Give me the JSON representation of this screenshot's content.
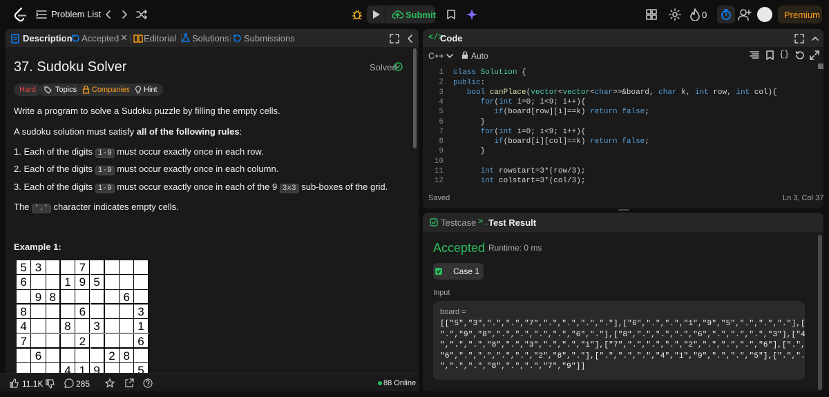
{
  "topbar": {
    "problem_list": "Problem List",
    "submit": "Submit",
    "premium": "Premium",
    "streak": "0",
    "logo": "leetcode-logo"
  },
  "left": {
    "tabs": {
      "description": "Description",
      "accepted": "Accepted",
      "editorial": "Editorial",
      "solutions": "Solutions",
      "submissions": "Submissions"
    },
    "title": "37. Sudoku Solver",
    "solved": "Solved",
    "tags": {
      "difficulty": "Hard",
      "topics": "Topics",
      "companies": "Companies",
      "hint": "Hint"
    },
    "p1": "Write a program to solve a Sudoku puzzle by filling the empty cells.",
    "p2a": "A sudoku solution must satisfy ",
    "p2b": "all of the following rules",
    ":": ":",
    "r1a": "1. Each of the digits ",
    "r1b": " must occur exactly once in each row.",
    "r2a": "2. Each of the digits ",
    "r2b": " must occur exactly once in each column.",
    "r3a": "3. Each of the digits ",
    "r3b": " must occur exactly once in each of the 9 ",
    "r3c": " sub-boxes of the grid.",
    "digits": "1-9",
    "box": "3x3",
    "p3a": "The ",
    "p3b": " character indicates empty cells.",
    "dot": "'.'",
    "example": "Example 1:",
    "grid": [
      [
        "5",
        "3",
        "",
        "",
        "7",
        "",
        "",
        "",
        ""
      ],
      [
        "6",
        "",
        "",
        "1",
        "9",
        "5",
        "",
        "",
        ""
      ],
      [
        "",
        "9",
        "8",
        "",
        "",
        "",
        "",
        "6",
        ""
      ],
      [
        "8",
        "",
        "",
        "",
        "6",
        "",
        "",
        "",
        "3"
      ],
      [
        "4",
        "",
        "",
        "8",
        "",
        "3",
        "",
        "",
        "1"
      ],
      [
        "7",
        "",
        "",
        "",
        "2",
        "",
        "",
        "",
        "6"
      ],
      [
        "",
        "6",
        "",
        "",
        "",
        "",
        "2",
        "8",
        ""
      ],
      [
        "",
        "",
        "",
        "4",
        "1",
        "9",
        "",
        "",
        "5"
      ]
    ],
    "likes": "11.1K",
    "comments": "285",
    "online": "88 Online"
  },
  "editor": {
    "header": "Code",
    "language": "C++",
    "mode": "Auto",
    "saved": "Saved",
    "cursor": "Ln 3, Col 37",
    "lines": [
      "1",
      "2",
      "3",
      "4",
      "5",
      "6",
      "7",
      "8",
      "9",
      "10",
      "11",
      "12"
    ]
  },
  "result": {
    "tabs": {
      "testcase": "Testcase",
      "test_result": "Test Result"
    },
    "status": "Accepted",
    "runtime": "Runtime: 0 ms",
    "case": "Case 1",
    "input_label": "Input",
    "var": "board =",
    "input_lines": [
      "[[\"5\",\"3\",\".\",\".\",\"7\",\".\",\".\",\".\",\".\"],[\"6\",\".\",\".\",\"1\",\"9\",\"5\",\".\",\".\",\".\"],[",
      "\".\",\"9\",\"8\",\".\",\".\",\".\",\".\",\"6\",\".\"],[\"8\",\".\",\".\",\".\",\"6\",\".\",\".\",\".\",\"3\"],[\"4",
      "\",\".\",\".\",\"8\",\".\",\"3\",\".\",\".\",\"1\"],[\"7\",\".\",\".\",\".\",\"2\",\".\",\".\",\".\",\"6\"],[\".\",",
      "\"6\",\".\",\".\",\".\",\".\",\"2\",\"8\",\".\"],[\".\",\".\",\".\",\"4\",\"1\",\"9\",\".\",\".\",\"5\"],[\".\",\".",
      "\",\".\",\".\",\"8\",\".\",\".\",\"7\",\"9\"]]"
    ]
  },
  "colors": {
    "accent": "#ffa116",
    "green": "#2cbb5d",
    "hard": "#ef4743",
    "blue": "#0a84ff"
  }
}
